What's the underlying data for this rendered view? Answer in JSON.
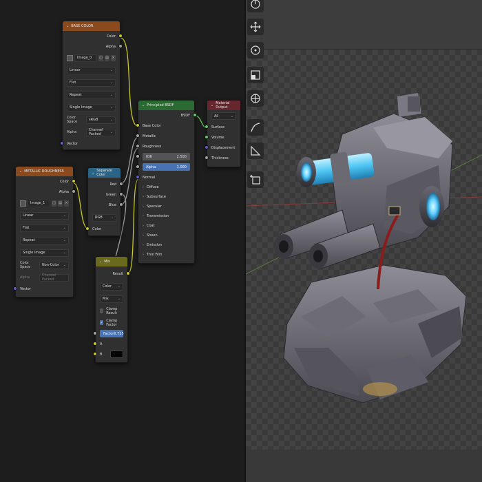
{
  "nodes": {
    "base_color": {
      "title": "BASE COLOR",
      "out_color": "Color",
      "out_alpha": "Alpha",
      "image_name": "Image_0",
      "interpolation": "Linear",
      "projection": "Flat",
      "extension": "Repeat",
      "source": "Single Image",
      "color_space_label": "Color Space",
      "color_space": "sRGB",
      "alpha_label": "Alpha",
      "alpha_mode": "Channel Packed",
      "vector_label": "Vector"
    },
    "metallic_roughness": {
      "title": "METALLIC ROUGHNESS",
      "out_color": "Color",
      "out_alpha": "Alpha",
      "image_name": "Image_1",
      "interpolation": "Linear",
      "projection": "Flat",
      "extension": "Repeat",
      "source": "Single Image",
      "color_space_label": "Color Space",
      "color_space": "Non-Color",
      "alpha_label": "Alpha",
      "alpha_mode": "Channel Packed",
      "vector_label": "Vector"
    },
    "separate_color": {
      "title": "Separate Color",
      "out_red": "Red",
      "out_green": "Green",
      "out_blue": "Blue",
      "mode": "RGB",
      "in_color": "Color"
    },
    "principled_bsdf": {
      "title": "Principled BSDF",
      "out_bsdf": "BSDF",
      "base_color": "Base Color",
      "metallic": "Metallic",
      "roughness": "Roughness",
      "ior_label": "IOR",
      "ior_value": "2.500",
      "alpha_label": "Alpha",
      "alpha_value": "1.000",
      "normal": "Normal",
      "sections": [
        "Diffuse",
        "Subsurface",
        "Specular",
        "Transmission",
        "Coat",
        "Sheen",
        "Emission",
        "Thin Film"
      ]
    },
    "material_output": {
      "title": "Material Output",
      "target": "All",
      "surface": "Surface",
      "volume": "Volume",
      "displacement": "Displacement",
      "thickness": "Thickness"
    },
    "mix": {
      "title": "Mix",
      "out_result": "Result",
      "data_type": "Color",
      "blend_mode": "Mix",
      "clamp_result": "Clamp Result",
      "clamp_factor": "Clamp Factor",
      "factor_label": "Factor",
      "factor_value": "0.725",
      "in_a": "A",
      "in_b": "B"
    }
  },
  "viewport": {
    "tools": [
      "transform-gizmo-icon",
      "move-icon",
      "rotate-icon",
      "scale-icon",
      "transform-icon",
      "annotate-icon",
      "measure-icon",
      "add-cube-icon"
    ]
  },
  "colors": {
    "texture_header": "#8a4a1e",
    "converter_header": "#2a6487",
    "shader_header": "#2b6a32",
    "output_header": "#66262e",
    "mix_header": "#6a6a1e",
    "link_yellow": "#c9c92b",
    "link_gray": "#a0a0a0",
    "link_green": "#5fbf5f"
  }
}
